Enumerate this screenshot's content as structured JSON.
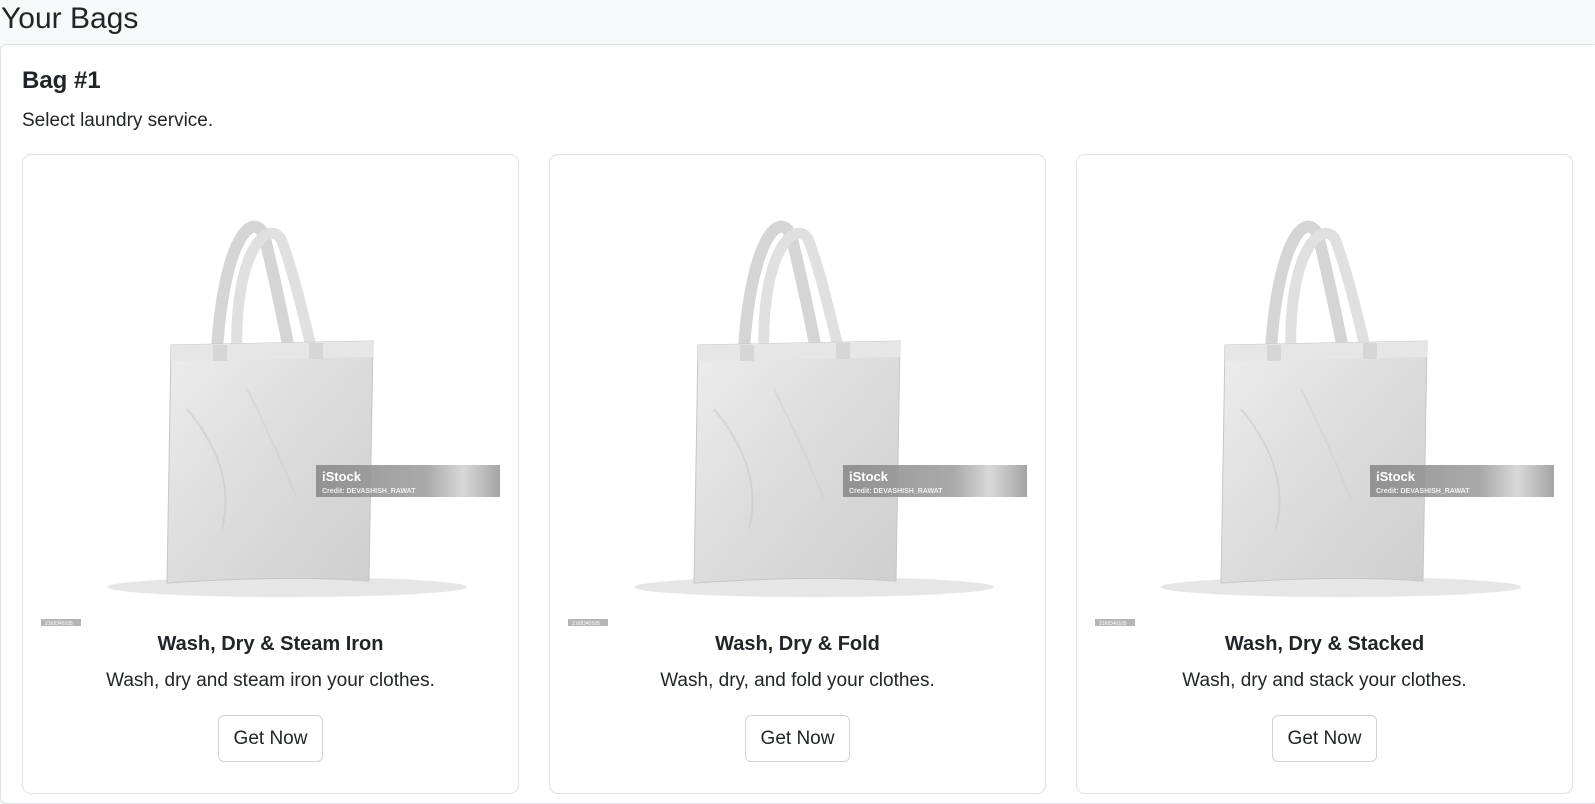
{
  "page": {
    "title": "Your Bags"
  },
  "bag": {
    "heading": "Bag #1",
    "subtitle": "Select laundry service.",
    "services": [
      {
        "title": "Wash, Dry & Steam Iron",
        "description": "Wash, dry and steam iron your clothes.",
        "button_label": "Get Now",
        "image": {
          "brand": "iStock",
          "credit": "Credit: DEVASHISH_RAWAT",
          "id_tag": "2168340105"
        }
      },
      {
        "title": "Wash, Dry & Fold",
        "description": "Wash, dry, and fold your clothes.",
        "button_label": "Get Now",
        "image": {
          "brand": "iStock",
          "credit": "Credit: DEVASHISH_RAWAT",
          "id_tag": "2168340105"
        }
      },
      {
        "title": "Wash, Dry & Stacked",
        "description": "Wash, dry and stack your clothes.",
        "button_label": "Get Now",
        "image": {
          "brand": "iStock",
          "credit": "Credit: DEVASHISH_RAWAT",
          "id_tag": "2168340105"
        }
      }
    ]
  }
}
